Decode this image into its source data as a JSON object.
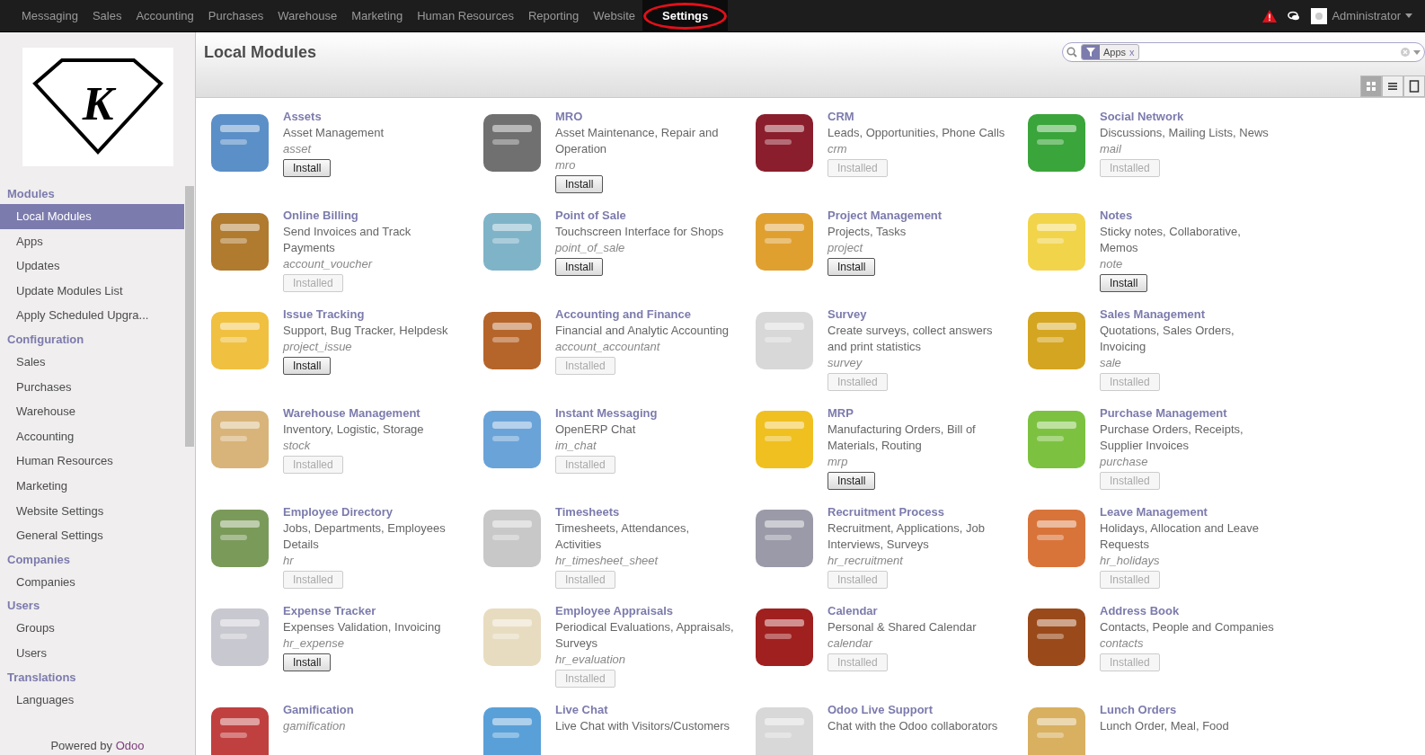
{
  "top_menu": [
    {
      "label": "Messaging",
      "selected": false
    },
    {
      "label": "Sales",
      "selected": false
    },
    {
      "label": "Accounting",
      "selected": false
    },
    {
      "label": "Purchases",
      "selected": false
    },
    {
      "label": "Warehouse",
      "selected": false
    },
    {
      "label": "Marketing",
      "selected": false
    },
    {
      "label": "Human Resources",
      "selected": false
    },
    {
      "label": "Reporting",
      "selected": false
    },
    {
      "label": "Website",
      "selected": false
    },
    {
      "label": "Settings",
      "selected": true
    }
  ],
  "user": {
    "name": "Administrator"
  },
  "logo": {
    "letter": "K"
  },
  "sidebar": [
    {
      "title": "Modules",
      "items": [
        {
          "label": "Local Modules",
          "selected": true
        },
        {
          "label": "Apps",
          "selected": false
        },
        {
          "label": "Updates",
          "selected": false
        },
        {
          "label": "Update Modules List",
          "selected": false
        },
        {
          "label": "Apply Scheduled Upgra...",
          "selected": false
        }
      ]
    },
    {
      "title": "Configuration",
      "items": [
        {
          "label": "Sales",
          "selected": false
        },
        {
          "label": "Purchases",
          "selected": false
        },
        {
          "label": "Warehouse",
          "selected": false
        },
        {
          "label": "Accounting",
          "selected": false
        },
        {
          "label": "Human Resources",
          "selected": false
        },
        {
          "label": "Marketing",
          "selected": false
        },
        {
          "label": "Website Settings",
          "selected": false
        },
        {
          "label": "General Settings",
          "selected": false
        }
      ]
    },
    {
      "title": "Companies",
      "items": [
        {
          "label": "Companies",
          "selected": false
        }
      ]
    },
    {
      "title": "Users",
      "items": [
        {
          "label": "Groups",
          "selected": false
        },
        {
          "label": "Users",
          "selected": false
        }
      ]
    },
    {
      "title": "Translations",
      "items": [
        {
          "label": "Languages",
          "selected": false
        }
      ]
    }
  ],
  "footer": {
    "prefix": "Powered by",
    "link": "Odoo"
  },
  "page_title": "Local Modules",
  "search": {
    "facet": "Apps",
    "facet_remove": "x"
  },
  "views": [
    {
      "kind": "kanban",
      "selected": true
    },
    {
      "kind": "list",
      "selected": false
    },
    {
      "kind": "form",
      "selected": false
    }
  ],
  "modules": [
    {
      "name": "Assets",
      "summary": "Asset Management",
      "technical": "asset",
      "button": {
        "label": "Install",
        "disabled": false
      }
    },
    {
      "name": "MRO",
      "summary": "Asset Maintenance, Repair and Operation",
      "technical": "mro",
      "button": {
        "label": "Install",
        "disabled": false
      }
    },
    {
      "name": "CRM",
      "summary": "Leads, Opportunities, Phone Calls",
      "technical": "crm",
      "button": {
        "label": "Installed",
        "disabled": true
      }
    },
    {
      "name": "Social Network",
      "summary": "Discussions, Mailing Lists, News",
      "technical": "mail",
      "button": {
        "label": "Installed",
        "disabled": true
      }
    },
    {
      "name": "Online Billing",
      "summary": "Send Invoices and Track Payments",
      "technical": "account_voucher",
      "button": {
        "label": "Installed",
        "disabled": true
      }
    },
    {
      "name": "Point of Sale",
      "summary": "Touchscreen Interface for Shops",
      "technical": "point_of_sale",
      "button": {
        "label": "Install",
        "disabled": false
      }
    },
    {
      "name": "Project Management",
      "summary": "Projects, Tasks",
      "technical": "project",
      "button": {
        "label": "Install",
        "disabled": false
      }
    },
    {
      "name": "Notes",
      "summary": "Sticky notes, Collaborative, Memos",
      "technical": "note",
      "button": {
        "label": "Install",
        "disabled": false
      }
    },
    {
      "name": "Issue Tracking",
      "summary": "Support, Bug Tracker, Helpdesk",
      "technical": "project_issue",
      "button": {
        "label": "Install",
        "disabled": false
      }
    },
    {
      "name": "Accounting and Finance",
      "summary": "Financial and Analytic Accounting",
      "technical": "account_accountant",
      "button": {
        "label": "Installed",
        "disabled": true
      }
    },
    {
      "name": "Survey",
      "summary": "Create surveys, collect answers and print statistics",
      "technical": "survey",
      "button": {
        "label": "Installed",
        "disabled": true
      }
    },
    {
      "name": "Sales Management",
      "summary": "Quotations, Sales Orders, Invoicing",
      "technical": "sale",
      "button": {
        "label": "Installed",
        "disabled": true
      }
    },
    {
      "name": "Warehouse Management",
      "summary": "Inventory, Logistic, Storage",
      "technical": "stock",
      "button": {
        "label": "Installed",
        "disabled": true
      }
    },
    {
      "name": "Instant Messaging",
      "summary": "OpenERP Chat",
      "technical": "im_chat",
      "button": {
        "label": "Installed",
        "disabled": true
      }
    },
    {
      "name": "MRP",
      "summary": "Manufacturing Orders, Bill of Materials, Routing",
      "technical": "mrp",
      "button": {
        "label": "Install",
        "disabled": false
      }
    },
    {
      "name": "Purchase Management",
      "summary": "Purchase Orders, Receipts, Supplier Invoices",
      "technical": "purchase",
      "button": {
        "label": "Installed",
        "disabled": true
      }
    },
    {
      "name": "Employee Directory",
      "summary": "Jobs, Departments, Employees Details",
      "technical": "hr",
      "button": {
        "label": "Installed",
        "disabled": true
      }
    },
    {
      "name": "Timesheets",
      "summary": "Timesheets, Attendances, Activities",
      "technical": "hr_timesheet_sheet",
      "button": {
        "label": "Installed",
        "disabled": true
      }
    },
    {
      "name": "Recruitment Process",
      "summary": "Recruitment, Applications, Job Interviews, Surveys",
      "technical": "hr_recruitment",
      "button": {
        "label": "Installed",
        "disabled": true
      }
    },
    {
      "name": "Leave Management",
      "summary": "Holidays, Allocation and Leave Requests",
      "technical": "hr_holidays",
      "button": {
        "label": "Installed",
        "disabled": true
      }
    },
    {
      "name": "Expense Tracker",
      "summary": "Expenses Validation, Invoicing",
      "technical": "hr_expense",
      "button": {
        "label": "Install",
        "disabled": false
      }
    },
    {
      "name": "Employee Appraisals",
      "summary": "Periodical Evaluations, Appraisals, Surveys",
      "technical": "hr_evaluation",
      "button": {
        "label": "Installed",
        "disabled": true
      }
    },
    {
      "name": "Calendar",
      "summary": "Personal & Shared Calendar",
      "technical": "calendar",
      "button": {
        "label": "Installed",
        "disabled": true
      }
    },
    {
      "name": "Address Book",
      "summary": "Contacts, People and Companies",
      "technical": "contacts",
      "button": {
        "label": "Installed",
        "disabled": true
      }
    },
    {
      "name": "Gamification",
      "technical": "gamification"
    },
    {
      "name": "Live Chat",
      "summary": "Live Chat with Visitors/Customers"
    },
    {
      "name": "Odoo Live Support",
      "summary": "Chat with the Odoo collaborators"
    },
    {
      "name": "Lunch Orders",
      "summary": "Lunch Order, Meal, Food"
    }
  ]
}
